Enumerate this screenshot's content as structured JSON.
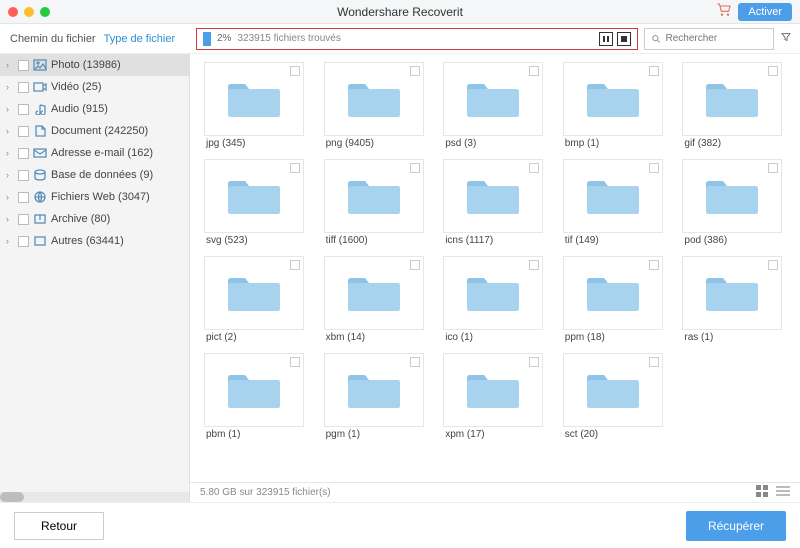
{
  "titlebar": {
    "title": "Wondershare Recoverit",
    "activate": "Activer"
  },
  "tabs": {
    "path": "Chemin du fichier",
    "type": "Type de fichier"
  },
  "progress": {
    "percent": "2%",
    "status": "323915 fichiers trouvés"
  },
  "search": {
    "placeholder": "Rechercher"
  },
  "sidebar": [
    {
      "label": "Photo (13986)",
      "selected": true,
      "icon": "photo"
    },
    {
      "label": "Vidéo (25)",
      "icon": "video"
    },
    {
      "label": "Audio (915)",
      "icon": "audio"
    },
    {
      "label": "Document (242250)",
      "icon": "document"
    },
    {
      "label": "Adresse e-mail (162)",
      "icon": "email"
    },
    {
      "label": "Base de données (9)",
      "icon": "database"
    },
    {
      "label": "Fichiers Web (3047)",
      "icon": "web"
    },
    {
      "label": "Archive (80)",
      "icon": "archive"
    },
    {
      "label": "Autres (63441)",
      "icon": "other"
    }
  ],
  "folders": [
    {
      "label": "jpg (345)"
    },
    {
      "label": "png (9405)"
    },
    {
      "label": "psd (3)"
    },
    {
      "label": "bmp (1)"
    },
    {
      "label": "gif (382)"
    },
    {
      "label": "svg (523)"
    },
    {
      "label": "tiff (1600)"
    },
    {
      "label": "icns (1117)"
    },
    {
      "label": "tif (149)"
    },
    {
      "label": "pod (386)"
    },
    {
      "label": "pict (2)"
    },
    {
      "label": "xbm (14)"
    },
    {
      "label": "ico (1)"
    },
    {
      "label": "ppm (18)"
    },
    {
      "label": "ras (1)"
    },
    {
      "label": "pbm (1)"
    },
    {
      "label": "pgm (1)"
    },
    {
      "label": "xpm (17)"
    },
    {
      "label": "sct (20)"
    }
  ],
  "status": {
    "text": "5.80 GB sur 323915 fichier(s)"
  },
  "footer": {
    "back": "Retour",
    "recover": "Récupérer"
  }
}
